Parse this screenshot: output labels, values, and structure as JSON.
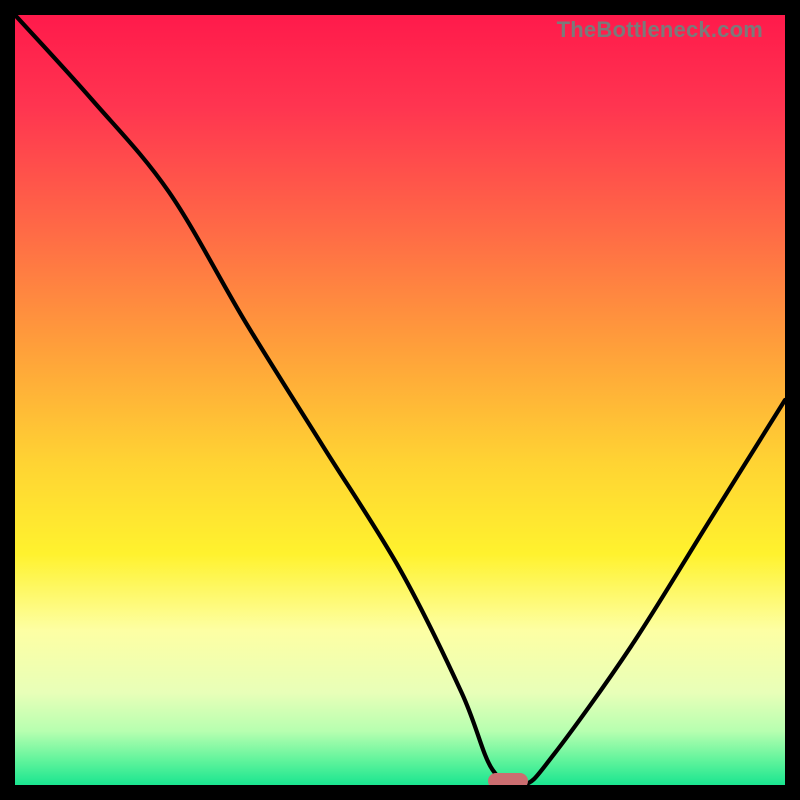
{
  "watermark": "TheBottleneck.com",
  "chart_data": {
    "type": "line",
    "title": "",
    "xlabel": "",
    "ylabel": "",
    "xlim": [
      0,
      100
    ],
    "ylim": [
      0,
      100
    ],
    "grid": false,
    "legend": false,
    "series": [
      {
        "name": "bottleneck-curve",
        "x": [
          0,
          10,
          20,
          30,
          40,
          50,
          58,
          62,
          66,
          70,
          80,
          90,
          100
        ],
        "values": [
          100,
          89,
          77,
          60,
          44,
          28,
          12,
          2,
          0,
          4,
          18,
          34,
          50
        ]
      }
    ],
    "marker": {
      "x": 64,
      "y": 0.5
    },
    "gradient_stops": [
      {
        "offset": 0.0,
        "color": "#ff1a4b"
      },
      {
        "offset": 0.12,
        "color": "#ff3550"
      },
      {
        "offset": 0.28,
        "color": "#ff6a46"
      },
      {
        "offset": 0.44,
        "color": "#ffa23a"
      },
      {
        "offset": 0.58,
        "color": "#ffd333"
      },
      {
        "offset": 0.7,
        "color": "#fff22e"
      },
      {
        "offset": 0.8,
        "color": "#fdffa4"
      },
      {
        "offset": 0.88,
        "color": "#e8ffb8"
      },
      {
        "offset": 0.93,
        "color": "#b7ffb0"
      },
      {
        "offset": 0.97,
        "color": "#5cf39b"
      },
      {
        "offset": 1.0,
        "color": "#1ae590"
      }
    ]
  }
}
